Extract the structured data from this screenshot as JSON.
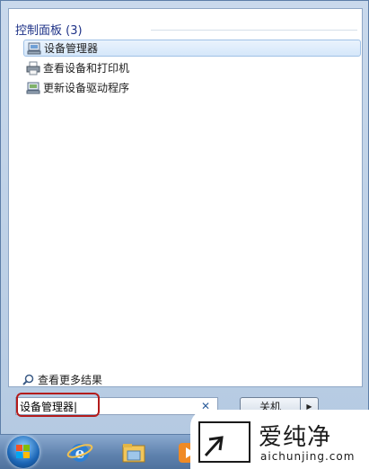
{
  "start_menu": {
    "section_header": "控制面板 (3)",
    "results": [
      {
        "label": "设备管理器",
        "icon": "device-manager-icon",
        "selected": true
      },
      {
        "label": "查看设备和打印机",
        "icon": "printer-icon",
        "selected": false
      },
      {
        "label": "更新设备驱动程序",
        "icon": "device-driver-icon",
        "selected": false
      }
    ],
    "see_more": "查看更多结果",
    "search": {
      "value": "设备管理器|",
      "placeholder": ""
    },
    "shutdown_label": "关机"
  },
  "watermark": {
    "title": "爱纯净",
    "url": "aichunjing.com"
  },
  "colors": {
    "accent": "#1e3287",
    "highlight_ring": "#b31b1b",
    "selected_bg": "#d5e7fa"
  }
}
